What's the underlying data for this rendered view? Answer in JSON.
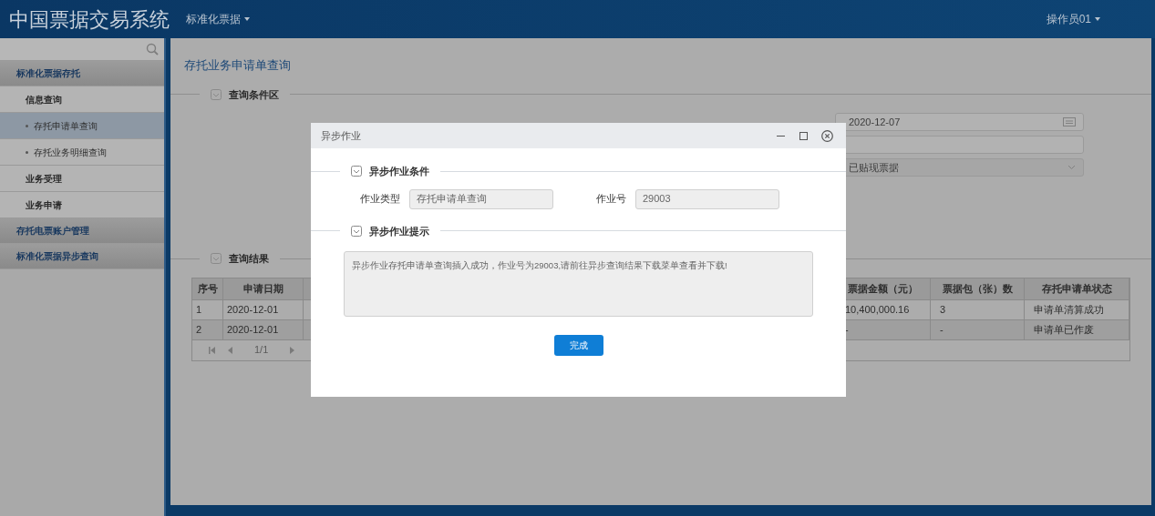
{
  "header": {
    "title": "中国票据交易系统",
    "menu": "标准化票据",
    "user": "操作员01"
  },
  "sidebar": {
    "items": [
      {
        "label": "标准化票据存托",
        "selected": false,
        "children": [
          {
            "label": "信息查询",
            "selected": false,
            "children": [
              {
                "label": "存托申请单查询",
                "selected": true
              },
              {
                "label": "存托业务明细查询",
                "selected": false
              }
            ]
          },
          {
            "label": "业务受理",
            "selected": false
          },
          {
            "label": "业务申请",
            "selected": false
          }
        ]
      },
      {
        "label": "存托电票账户管理",
        "selected": false
      },
      {
        "label": "标准化票据异步查询",
        "selected": false
      }
    ]
  },
  "page": {
    "title": "存托业务申请单查询",
    "conditions": {
      "title": "查询条件区",
      "fields": [
        {
          "kind": "date",
          "value": "2020-12-07"
        },
        {
          "kind": "text"
        },
        {
          "kind": "select",
          "value": "已贴现票据"
        }
      ]
    },
    "results": {
      "title": "查询结果",
      "columns": [
        "序号",
        "申请日期",
        "票据金额（元）",
        "票据包（张）数",
        "存托申请单状态"
      ],
      "rows": [
        {
          "cells": [
            "1",
            "2020-12-01",
            "10,400,000.16",
            "3",
            "申请单清算成功"
          ]
        },
        {
          "cells": [
            "2",
            "2020-12-01",
            "-",
            "-",
            "申请单已作废"
          ]
        }
      ],
      "pager": "1/1"
    }
  },
  "dialog": {
    "title": "异步作业",
    "sections": [
      {
        "title": "异步作业条件"
      },
      {
        "title": "异步作业提示"
      }
    ],
    "fields": [
      {
        "label": "作业类型",
        "value": "存托申请单查询"
      },
      {
        "label": "作业号",
        "value": "29003"
      }
    ],
    "message": "异步作业存托申请单查询插入成功，作业号为29003,请前往异步查询结果下载菜单查看并下载!",
    "button": "完成"
  }
}
